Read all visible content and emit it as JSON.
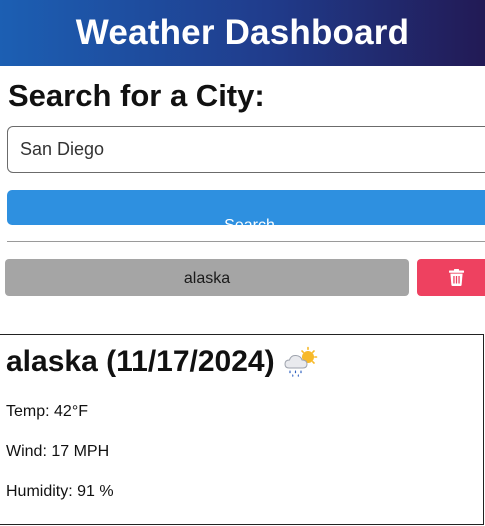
{
  "header": {
    "title": "Weather Dashboard"
  },
  "search": {
    "heading": "Search for a City:",
    "input_value": "San Diego",
    "button_label": "Search"
  },
  "history": {
    "items": [
      {
        "label": "alaska"
      }
    ],
    "delete_icon": "trash-icon",
    "delete_color": "#ee4160"
  },
  "current": {
    "city": "alaska",
    "date": "(11/17/2024)",
    "icon": "cloud-rain-sun-icon",
    "temp": "Temp: 42°F",
    "wind": "Wind: 17 MPH",
    "humidity": "Humidity: 91 %"
  },
  "colors": {
    "header_start": "#1c5fb3",
    "header_end": "#221a55",
    "search_button": "#2e90e0",
    "history_button": "#a5a5a5"
  }
}
